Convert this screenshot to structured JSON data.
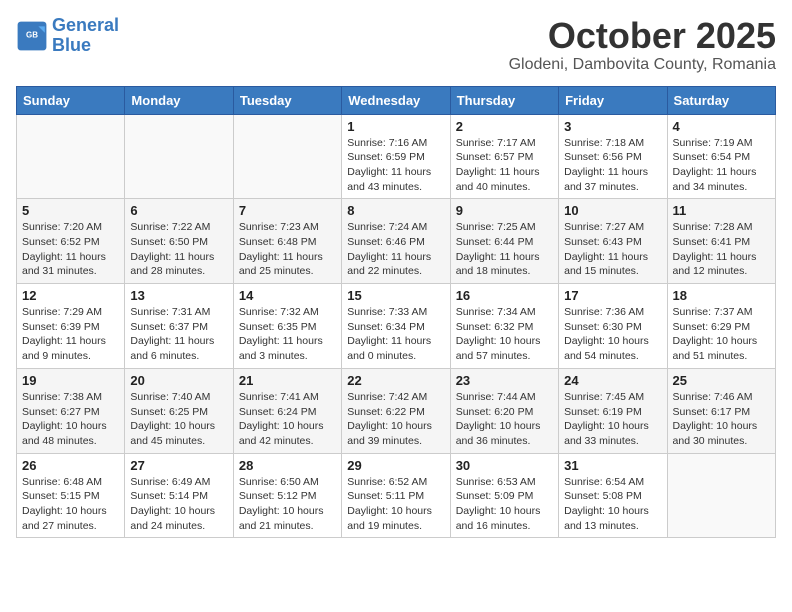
{
  "logo": {
    "line1": "General",
    "line2": "Blue"
  },
  "title": "October 2025",
  "subtitle": "Glodeni, Dambovita County, Romania",
  "days_of_week": [
    "Sunday",
    "Monday",
    "Tuesday",
    "Wednesday",
    "Thursday",
    "Friday",
    "Saturday"
  ],
  "weeks": [
    [
      {
        "day": "",
        "info": ""
      },
      {
        "day": "",
        "info": ""
      },
      {
        "day": "",
        "info": ""
      },
      {
        "day": "1",
        "info": "Sunrise: 7:16 AM\nSunset: 6:59 PM\nDaylight: 11 hours and 43 minutes."
      },
      {
        "day": "2",
        "info": "Sunrise: 7:17 AM\nSunset: 6:57 PM\nDaylight: 11 hours and 40 minutes."
      },
      {
        "day": "3",
        "info": "Sunrise: 7:18 AM\nSunset: 6:56 PM\nDaylight: 11 hours and 37 minutes."
      },
      {
        "day": "4",
        "info": "Sunrise: 7:19 AM\nSunset: 6:54 PM\nDaylight: 11 hours and 34 minutes."
      }
    ],
    [
      {
        "day": "5",
        "info": "Sunrise: 7:20 AM\nSunset: 6:52 PM\nDaylight: 11 hours and 31 minutes."
      },
      {
        "day": "6",
        "info": "Sunrise: 7:22 AM\nSunset: 6:50 PM\nDaylight: 11 hours and 28 minutes."
      },
      {
        "day": "7",
        "info": "Sunrise: 7:23 AM\nSunset: 6:48 PM\nDaylight: 11 hours and 25 minutes."
      },
      {
        "day": "8",
        "info": "Sunrise: 7:24 AM\nSunset: 6:46 PM\nDaylight: 11 hours and 22 minutes."
      },
      {
        "day": "9",
        "info": "Sunrise: 7:25 AM\nSunset: 6:44 PM\nDaylight: 11 hours and 18 minutes."
      },
      {
        "day": "10",
        "info": "Sunrise: 7:27 AM\nSunset: 6:43 PM\nDaylight: 11 hours and 15 minutes."
      },
      {
        "day": "11",
        "info": "Sunrise: 7:28 AM\nSunset: 6:41 PM\nDaylight: 11 hours and 12 minutes."
      }
    ],
    [
      {
        "day": "12",
        "info": "Sunrise: 7:29 AM\nSunset: 6:39 PM\nDaylight: 11 hours and 9 minutes."
      },
      {
        "day": "13",
        "info": "Sunrise: 7:31 AM\nSunset: 6:37 PM\nDaylight: 11 hours and 6 minutes."
      },
      {
        "day": "14",
        "info": "Sunrise: 7:32 AM\nSunset: 6:35 PM\nDaylight: 11 hours and 3 minutes."
      },
      {
        "day": "15",
        "info": "Sunrise: 7:33 AM\nSunset: 6:34 PM\nDaylight: 11 hours and 0 minutes."
      },
      {
        "day": "16",
        "info": "Sunrise: 7:34 AM\nSunset: 6:32 PM\nDaylight: 10 hours and 57 minutes."
      },
      {
        "day": "17",
        "info": "Sunrise: 7:36 AM\nSunset: 6:30 PM\nDaylight: 10 hours and 54 minutes."
      },
      {
        "day": "18",
        "info": "Sunrise: 7:37 AM\nSunset: 6:29 PM\nDaylight: 10 hours and 51 minutes."
      }
    ],
    [
      {
        "day": "19",
        "info": "Sunrise: 7:38 AM\nSunset: 6:27 PM\nDaylight: 10 hours and 48 minutes."
      },
      {
        "day": "20",
        "info": "Sunrise: 7:40 AM\nSunset: 6:25 PM\nDaylight: 10 hours and 45 minutes."
      },
      {
        "day": "21",
        "info": "Sunrise: 7:41 AM\nSunset: 6:24 PM\nDaylight: 10 hours and 42 minutes."
      },
      {
        "day": "22",
        "info": "Sunrise: 7:42 AM\nSunset: 6:22 PM\nDaylight: 10 hours and 39 minutes."
      },
      {
        "day": "23",
        "info": "Sunrise: 7:44 AM\nSunset: 6:20 PM\nDaylight: 10 hours and 36 minutes."
      },
      {
        "day": "24",
        "info": "Sunrise: 7:45 AM\nSunset: 6:19 PM\nDaylight: 10 hours and 33 minutes."
      },
      {
        "day": "25",
        "info": "Sunrise: 7:46 AM\nSunset: 6:17 PM\nDaylight: 10 hours and 30 minutes."
      }
    ],
    [
      {
        "day": "26",
        "info": "Sunrise: 6:48 AM\nSunset: 5:15 PM\nDaylight: 10 hours and 27 minutes."
      },
      {
        "day": "27",
        "info": "Sunrise: 6:49 AM\nSunset: 5:14 PM\nDaylight: 10 hours and 24 minutes."
      },
      {
        "day": "28",
        "info": "Sunrise: 6:50 AM\nSunset: 5:12 PM\nDaylight: 10 hours and 21 minutes."
      },
      {
        "day": "29",
        "info": "Sunrise: 6:52 AM\nSunset: 5:11 PM\nDaylight: 10 hours and 19 minutes."
      },
      {
        "day": "30",
        "info": "Sunrise: 6:53 AM\nSunset: 5:09 PM\nDaylight: 10 hours and 16 minutes."
      },
      {
        "day": "31",
        "info": "Sunrise: 6:54 AM\nSunset: 5:08 PM\nDaylight: 10 hours and 13 minutes."
      },
      {
        "day": "",
        "info": ""
      }
    ]
  ]
}
